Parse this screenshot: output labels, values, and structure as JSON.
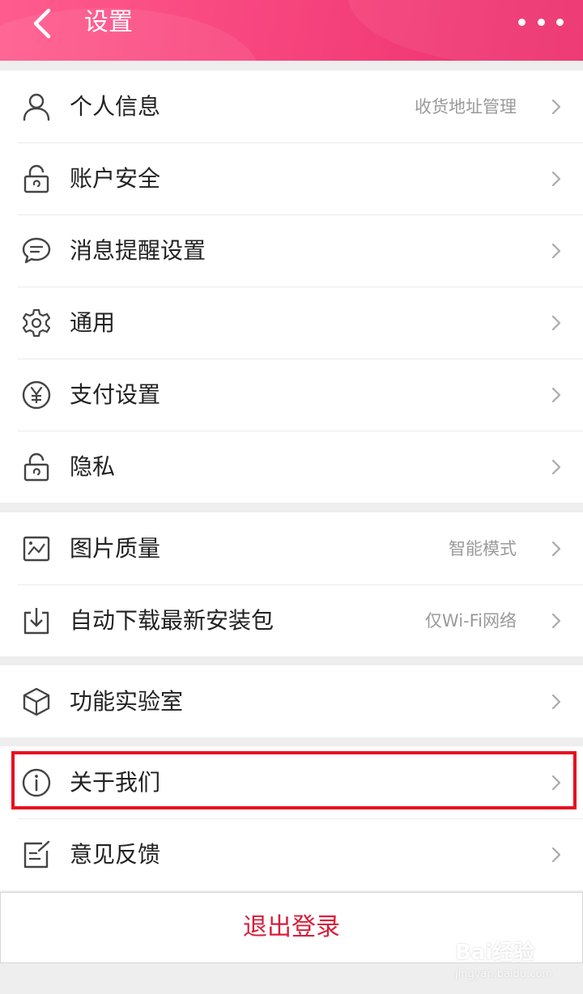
{
  "header": {
    "title": "设置",
    "back_icon": "chevron-left-icon",
    "more_icon": "more-dots-icon",
    "gradient": [
      "#ff5c8e",
      "#ec2f6d"
    ]
  },
  "groups": [
    [
      {
        "label": "个人信息",
        "value": "收货地址管理",
        "icon": "user-icon"
      },
      {
        "label": "账户安全",
        "value": "",
        "icon": "lock-icon"
      },
      {
        "label": "消息提醒设置",
        "value": "",
        "icon": "message-icon"
      },
      {
        "label": "通用",
        "value": "",
        "icon": "gear-icon"
      },
      {
        "label": "支付设置",
        "value": "",
        "icon": "yen-icon"
      },
      {
        "label": "隐私",
        "value": "",
        "icon": "lock-icon"
      }
    ],
    [
      {
        "label": "图片质量",
        "value": "智能模式",
        "icon": "image-icon"
      },
      {
        "label": "自动下载最新安装包",
        "value": "仅Wi-Fi网络",
        "icon": "download-icon"
      }
    ],
    [
      {
        "label": "功能实验室",
        "value": "",
        "icon": "cube-icon"
      }
    ],
    [
      {
        "label": "关于我们",
        "value": "",
        "icon": "info-icon"
      },
      {
        "label": "意见反馈",
        "value": "",
        "icon": "feedback-icon"
      }
    ]
  ],
  "logout": {
    "label": "退出登录",
    "color": "#d81e3a"
  },
  "highlight_color": "#e8101f",
  "watermark": {
    "text": "Bai经验",
    "subtext": "jingyan.baidu.com"
  }
}
